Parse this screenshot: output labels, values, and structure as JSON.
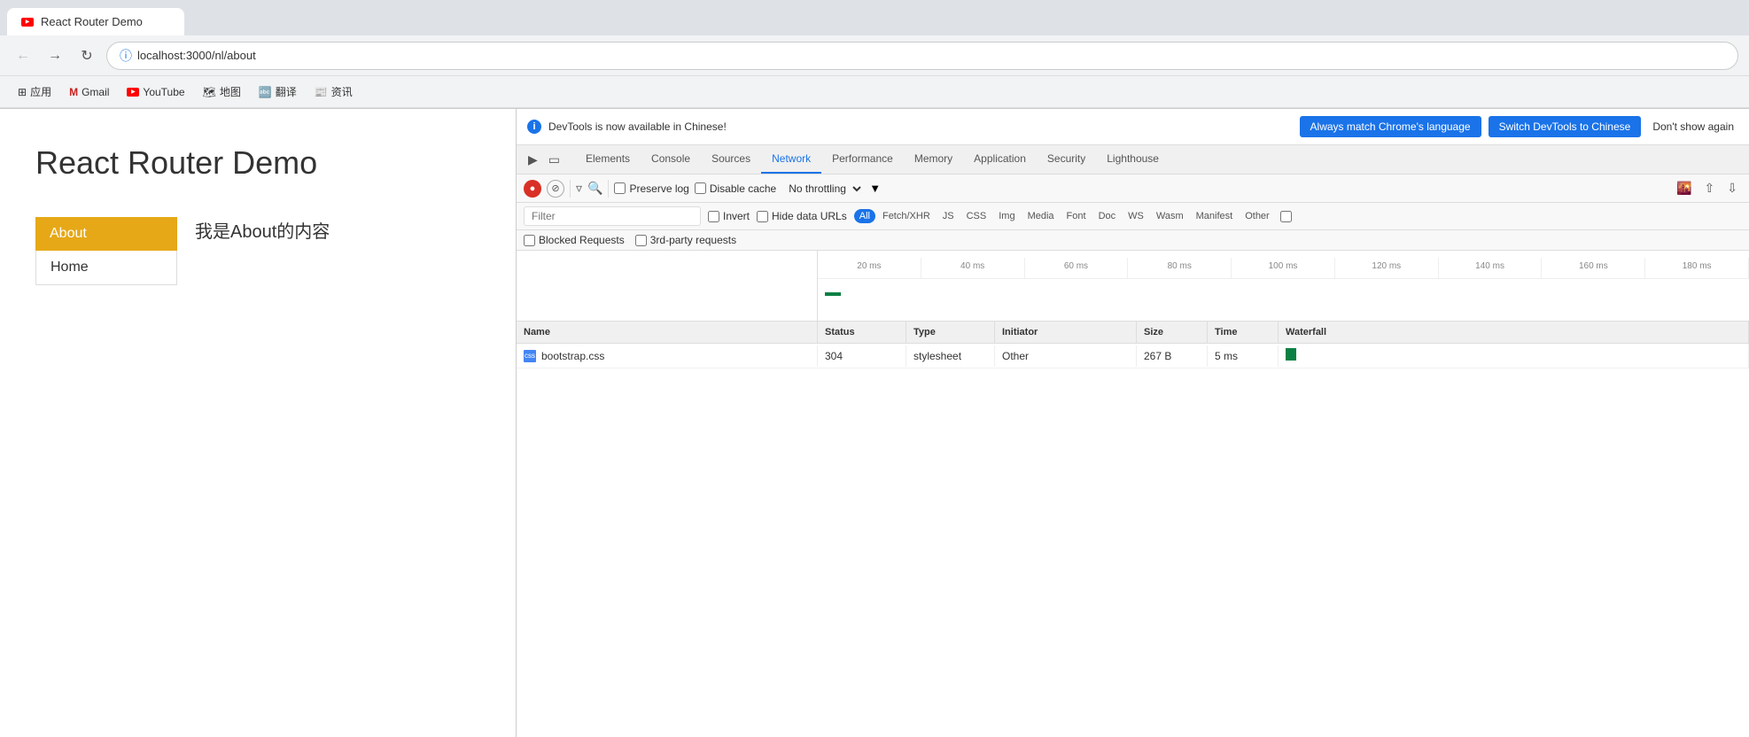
{
  "browser": {
    "tab_title": "React Router Demo",
    "url": "localhost:3000/nl/about"
  },
  "bookmarks": [
    {
      "id": "apps",
      "label": "应用",
      "icon": "grid"
    },
    {
      "id": "gmail",
      "label": "Gmail",
      "icon": "gmail"
    },
    {
      "id": "youtube",
      "label": "YouTube",
      "icon": "youtube"
    },
    {
      "id": "maps",
      "label": "地图",
      "icon": "maps"
    },
    {
      "id": "translate",
      "label": "翻译",
      "icon": "translate"
    },
    {
      "id": "news",
      "label": "资讯",
      "icon": "news"
    }
  ],
  "page": {
    "title": "React Router Demo",
    "nav": [
      {
        "label": "About",
        "active": true
      },
      {
        "label": "Home",
        "active": false
      }
    ],
    "body_text": "我是About的内容"
  },
  "devtools": {
    "notification": {
      "text": "DevTools is now available in Chinese!",
      "btn_match": "Always match Chrome's language",
      "btn_switch": "Switch DevTools to Chinese",
      "btn_dismiss": "Don't show again"
    },
    "tabs": [
      {
        "id": "elements",
        "label": "Elements",
        "active": false
      },
      {
        "id": "console",
        "label": "Console",
        "active": false
      },
      {
        "id": "sources",
        "label": "Sources",
        "active": false
      },
      {
        "id": "network",
        "label": "Network",
        "active": true
      },
      {
        "id": "performance",
        "label": "Performance",
        "active": false
      },
      {
        "id": "memory",
        "label": "Memory",
        "active": false
      },
      {
        "id": "application",
        "label": "Application",
        "active": false
      },
      {
        "id": "security",
        "label": "Security",
        "active": false
      },
      {
        "id": "lighthouse",
        "label": "Lighthouse",
        "active": false
      }
    ],
    "network": {
      "throttle": "No throttling",
      "filter_placeholder": "Filter",
      "filter_types": [
        "All",
        "Fetch/XHR",
        "JS",
        "CSS",
        "Img",
        "Media",
        "Font",
        "Doc",
        "WS",
        "Wasm",
        "Manifest",
        "Other"
      ],
      "active_filter": "All",
      "preserve_log": false,
      "disable_cache": false,
      "invert": false,
      "hide_data_urls": false,
      "blocked_requests": false,
      "third_party_requests": false,
      "timeline_ticks": [
        "20 ms",
        "40 ms",
        "60 ms",
        "80 ms",
        "100 ms",
        "120 ms",
        "140 ms",
        "160 ms",
        "180 ms"
      ],
      "table": {
        "columns": [
          "Name",
          "Status",
          "Type",
          "Initiator",
          "Size",
          "Time",
          "Waterfall"
        ],
        "rows": [
          {
            "name": "bootstrap.css",
            "status": "304",
            "type": "stylesheet",
            "initiator": "Other",
            "size": "267 B",
            "time": "5 ms"
          }
        ]
      }
    }
  }
}
